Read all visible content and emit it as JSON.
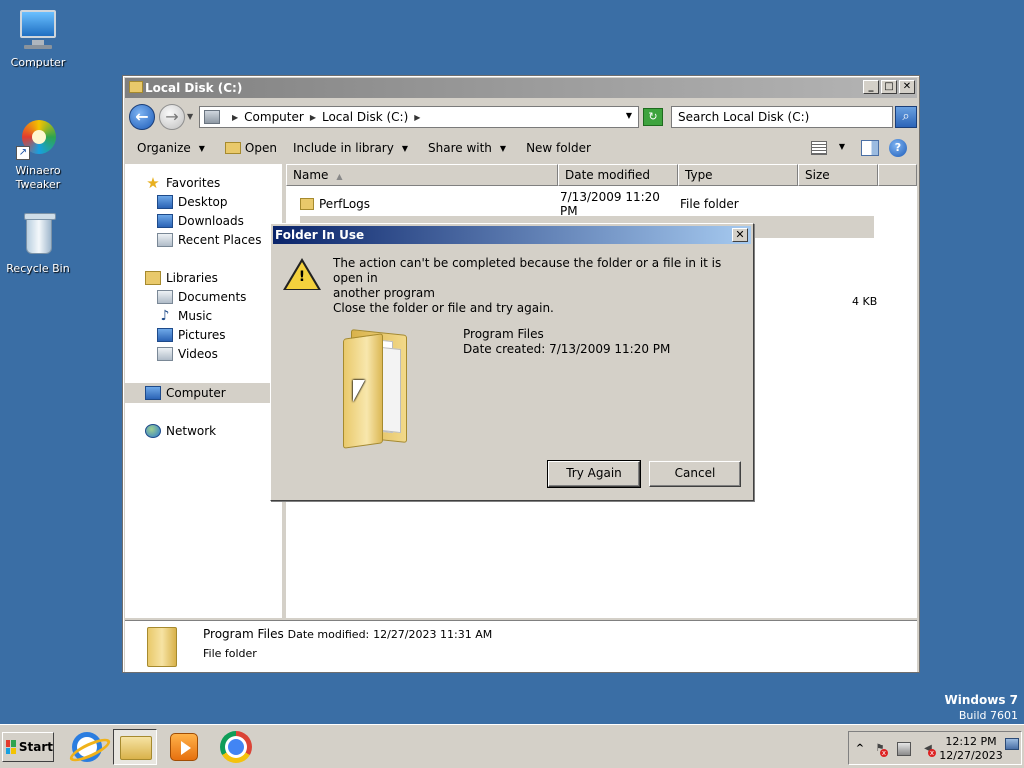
{
  "desktop": {
    "icons": [
      {
        "label": "Computer",
        "icon": "computer-icon"
      },
      {
        "label": "Winaero Tweaker",
        "icon": "winaero-tweaker-icon"
      },
      {
        "label": "Recycle Bin",
        "icon": "recycle-bin-icon"
      }
    ],
    "watermark": {
      "title": "Windows 7",
      "build": "Build 7601"
    }
  },
  "explorer": {
    "title": "Local Disk (C:)",
    "breadcrumb": [
      "Computer",
      "Local Disk (C:)"
    ],
    "search_placeholder": "Search Local Disk (C:)",
    "toolbar": {
      "organize": "Organize",
      "open": "Open",
      "include_in_library": "Include in library",
      "share_with": "Share with",
      "new_folder": "New folder"
    },
    "nav": {
      "favorites": "Favorites",
      "desktop": "Desktop",
      "downloads": "Downloads",
      "recent_places": "Recent Places",
      "libraries": "Libraries",
      "documents": "Documents",
      "music": "Music",
      "pictures": "Pictures",
      "videos": "Videos",
      "computer": "Computer",
      "network": "Network"
    },
    "columns": {
      "name": "Name",
      "date_modified": "Date modified",
      "type": "Type",
      "size": "Size"
    },
    "files": [
      {
        "name": "PerfLogs",
        "date": "7/13/2009 11:20 PM",
        "type": "File folder",
        "size": ""
      }
    ],
    "partial_size": "4 KB",
    "details": {
      "name": "Program Files",
      "date_label": "Date modified:",
      "date_value": "12/27/2023 11:31 AM",
      "type": "File folder"
    }
  },
  "dialog": {
    "title": "Folder In Use",
    "message_line1": "The action can't be completed because the folder or a file in it is open in",
    "message_line2": "another program",
    "message2": "Close the folder or file and try again.",
    "item_name": "Program Files",
    "item_date": "Date created: 7/13/2009 11:20 PM",
    "try_again": "Try Again",
    "cancel": "Cancel",
    "close_glyph": "✕"
  },
  "taskbar": {
    "start_label": "Start",
    "apps": [
      "internet-explorer-icon",
      "windows-explorer-icon",
      "media-player-icon",
      "chrome-icon"
    ],
    "clock_time": "12:12 PM",
    "clock_date": "12/27/2023"
  }
}
